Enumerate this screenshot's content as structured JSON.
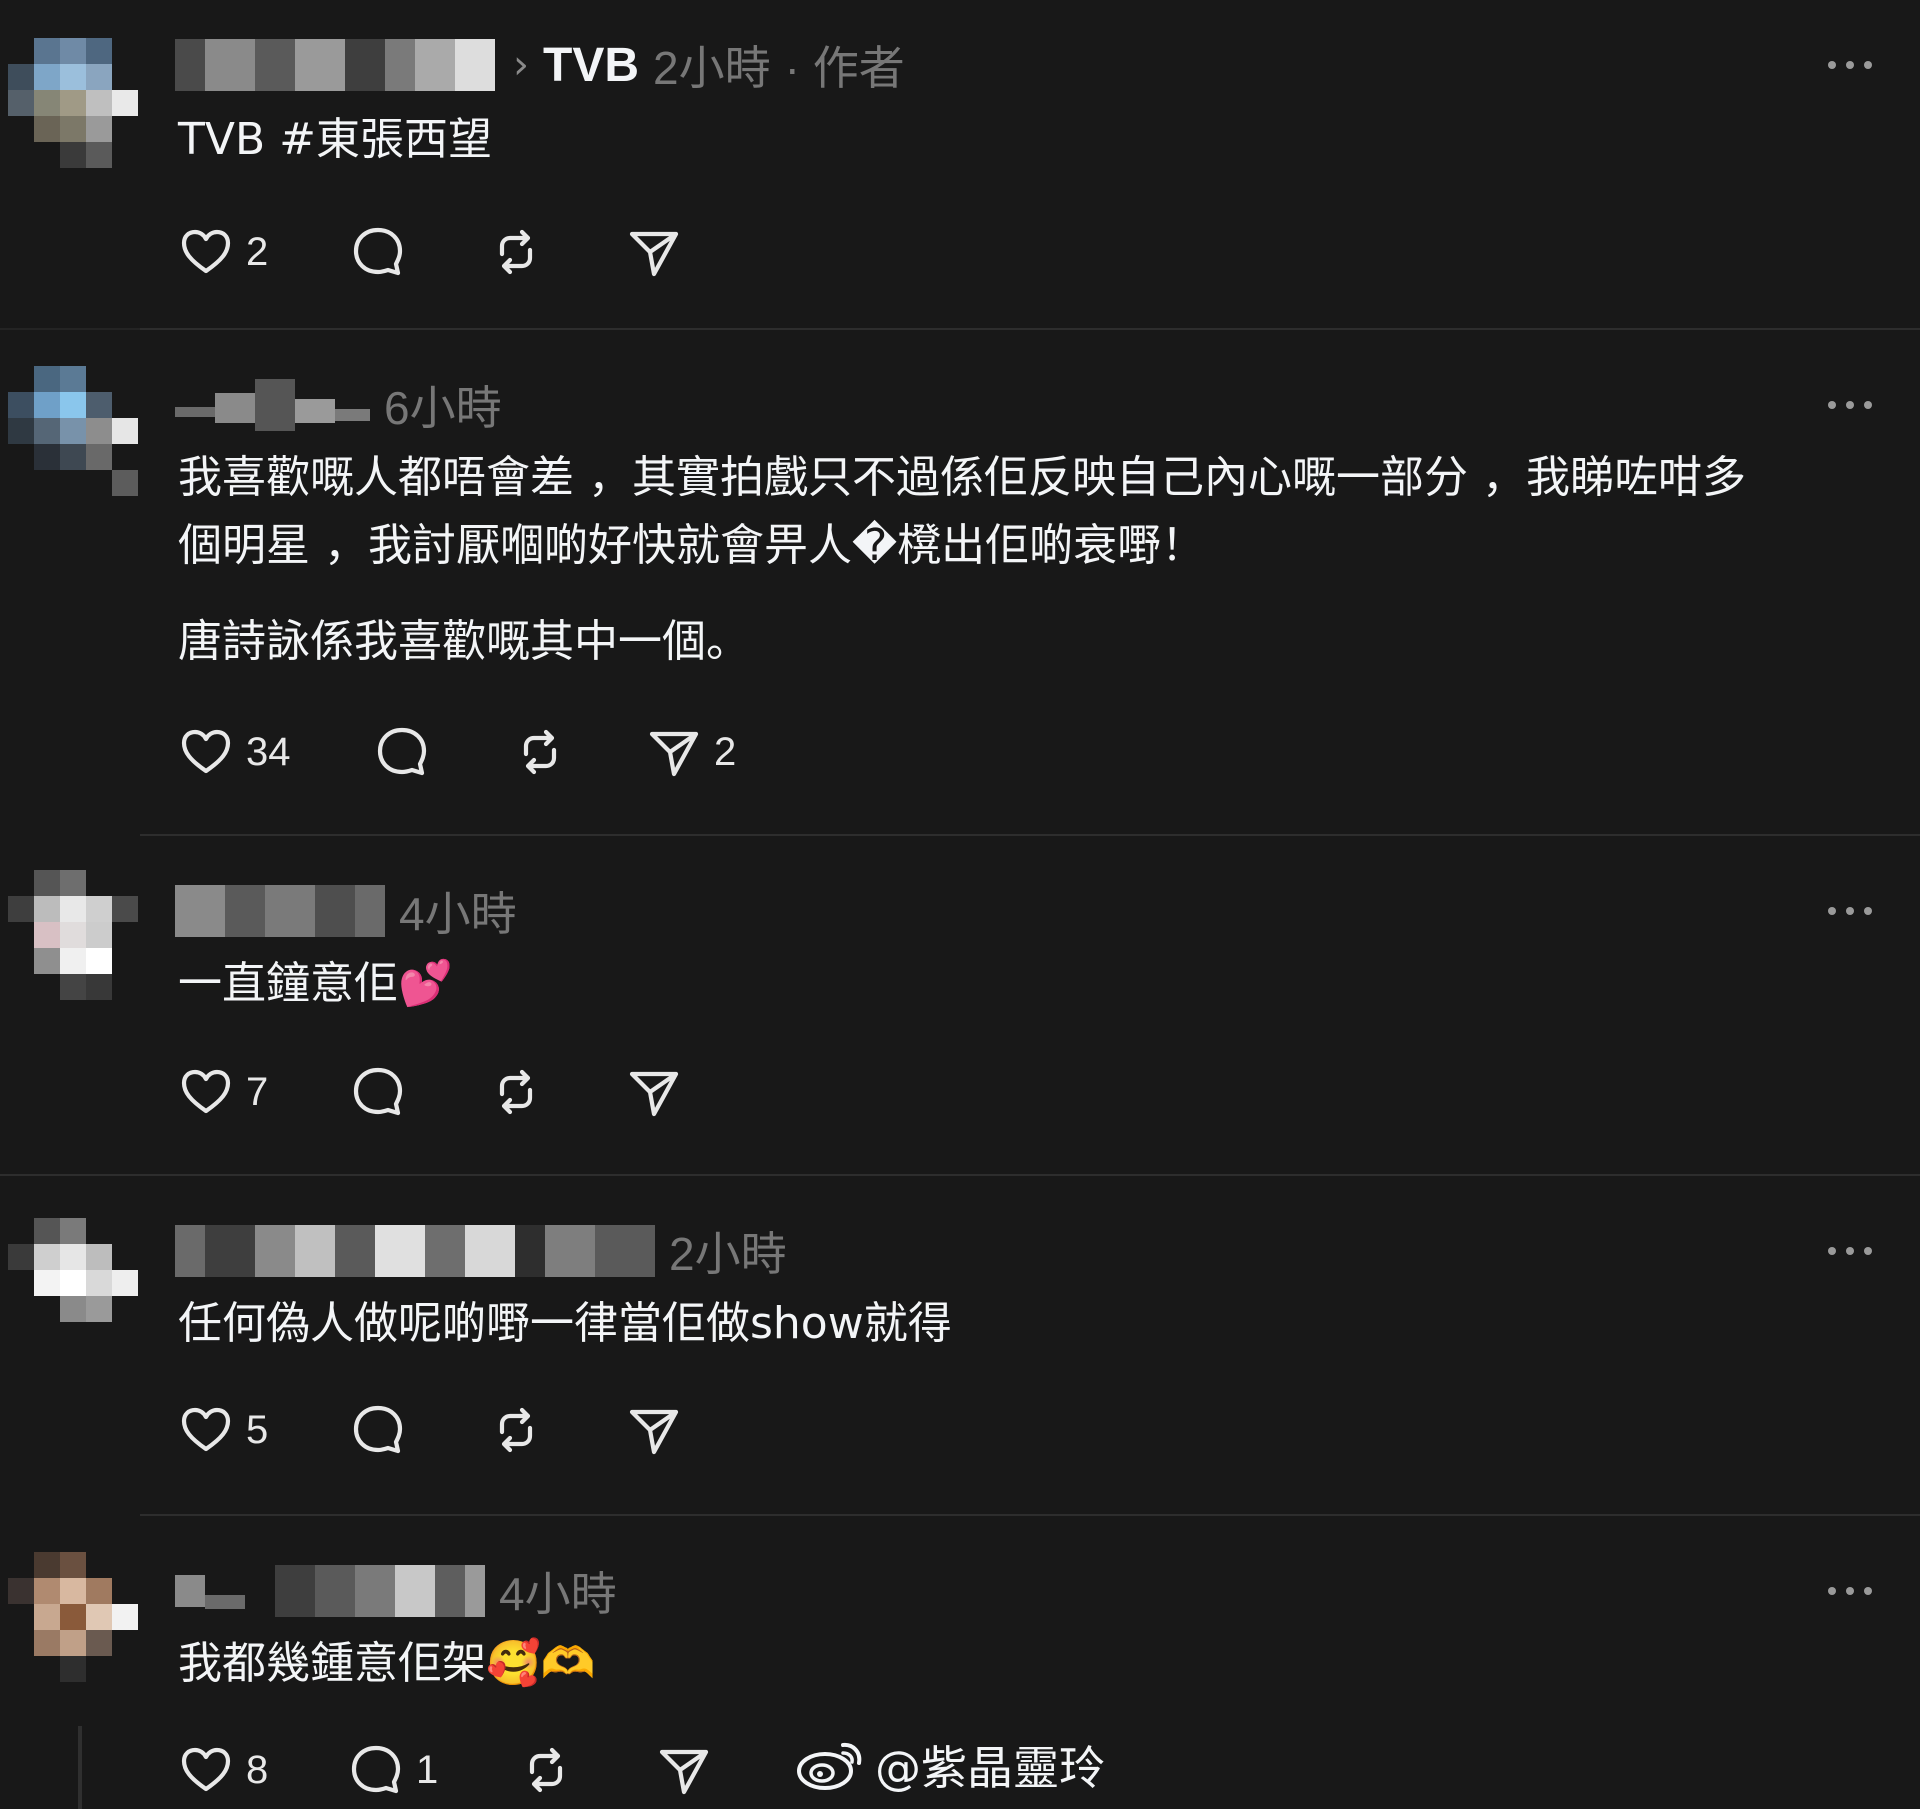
{
  "posts": [
    {
      "tag": "TVB",
      "time": "2小時",
      "author_label": "· 作者",
      "text": "TVB #東張西望",
      "likes": "2",
      "comments": "",
      "reposts": "",
      "shares": ""
    },
    {
      "time": "6小時",
      "text": "我喜歡嘅人都唔會差 ，其實拍戲只不過係佢反映自己內心嘅一部分 ，我睇咗咁多\n個明星 ，我討厭嗰啲好快就會畀人�櫈出佢啲衰嘢！",
      "text2": "唐詩詠係我喜歡嘅其中一個。",
      "likes": "34",
      "comments": "",
      "reposts": "",
      "shares": "2"
    },
    {
      "time": "4小時",
      "text": "一直鐘意佢💕",
      "likes": "7",
      "comments": "",
      "reposts": "",
      "shares": ""
    },
    {
      "time": "2小時",
      "text": "任何偽人做呢啲嘢一律當佢做show就得",
      "likes": "5",
      "comments": "",
      "reposts": "",
      "shares": ""
    },
    {
      "time": "4小時",
      "text": "我都幾鍾意佢架🥰🫶",
      "likes": "8",
      "comments": "1",
      "reposts": "",
      "shares": ""
    }
  ],
  "watermark": "@紫晶靈玲",
  "icons": {
    "like": "heart-icon",
    "comment": "comment-bubble-icon",
    "repost": "repost-icon",
    "share": "send-icon",
    "more": "more-options-icon",
    "watermark_logo": "weibo-logo-icon"
  }
}
